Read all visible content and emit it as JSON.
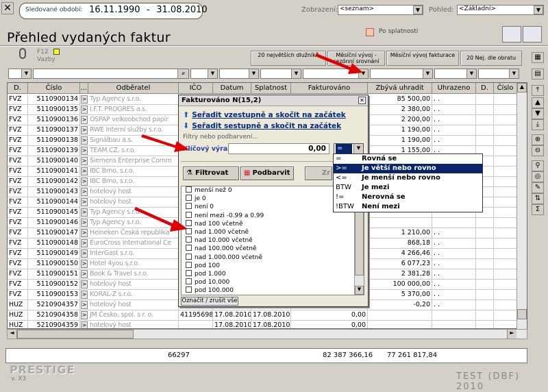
{
  "header": {
    "period_label": "Sledované období:",
    "date_from": "16.11.1990",
    "date_sep": "-",
    "date_to": "31.08.2010",
    "view_label": "Zobrazení:",
    "view_value": "<seznam>",
    "pohled_label": "Pohled:",
    "pohled_value": "<Základní>"
  },
  "title": "Přehled vydaných faktur",
  "po_splatnosti": "Po splatnosti",
  "toolbar": {
    "f12": "F12",
    "vazby": "Vazby",
    "btn1": "20 největších dlužníků",
    "btn2": "Měsíční vývoj - sezónní srovnání",
    "btn3": "Měsíční vývoj fakturace",
    "btn4": "20 Nej. dle obratu"
  },
  "columns": [
    "D.",
    "Číslo",
    "...",
    "Odběratel",
    "IČO",
    "Datum usk.",
    "Splatnost",
    "Fakturováno",
    "Zbývá uhradit",
    "Uhrazeno",
    "D.",
    "Číslo"
  ],
  "rows": [
    {
      "d": "FVZ",
      "cislo": "5110900134",
      "odb": "Typ Agency s.r.o.",
      "ico": "",
      "dusk": "",
      "spl": "",
      "fakt": "",
      "zbyva": "85 500,00",
      "uhr": ". ."
    },
    {
      "d": "FVZ",
      "cislo": "5110900135",
      "odb": "I.F.T. PROGRES a.s.",
      "ico": "",
      "dusk": "",
      "spl": "",
      "fakt": "",
      "zbyva": "2 380,00",
      "uhr": ". ."
    },
    {
      "d": "FVZ",
      "cislo": "5110900136",
      "odb": "OSPAP velkoobchod papír",
      "ico": "",
      "dusk": "",
      "spl": "",
      "fakt": "",
      "zbyva": "2 200,00",
      "uhr": ". ."
    },
    {
      "d": "FVZ",
      "cislo": "5110900137",
      "odb": "RWE Interní služby s.r.o.",
      "ico": "",
      "dusk": "",
      "spl": "",
      "fakt": "",
      "zbyva": "1 190,00",
      "uhr": ". ."
    },
    {
      "d": "FVZ",
      "cislo": "5110900138",
      "odb": "Signálbau a.s.",
      "ico": "",
      "dusk": "",
      "spl": "",
      "fakt": "",
      "zbyva": "1 190,00",
      "uhr": ". ."
    },
    {
      "d": "FVZ",
      "cislo": "5110900139",
      "odb": "TEAM.CZ, s.r.o.",
      "ico": "",
      "dusk": "",
      "spl": "",
      "fakt": "",
      "zbyva": "1 155,00",
      "uhr": ". ."
    },
    {
      "d": "FVZ",
      "cislo": "5110900140",
      "odb": "Siemens Enterprise Comm",
      "ico": "",
      "dusk": "",
      "spl": "",
      "fakt": "",
      "zbyva": "",
      "uhr": ""
    },
    {
      "d": "FVZ",
      "cislo": "5110900141",
      "odb": "IBC Brno, s.r.o.",
      "ico": "",
      "dusk": "",
      "spl": "",
      "fakt": "",
      "zbyva": "",
      "uhr": ""
    },
    {
      "d": "FVZ",
      "cislo": "5110900142",
      "odb": "IBC Brno, s.r.o.",
      "ico": "",
      "dusk": "",
      "spl": "",
      "fakt": "",
      "zbyva": "",
      "uhr": ""
    },
    {
      "d": "FVZ",
      "cislo": "5110900143",
      "odb": "hotelový host",
      "ico": "",
      "dusk": "",
      "spl": "",
      "fakt": "",
      "zbyva": "",
      "uhr": ""
    },
    {
      "d": "FVZ",
      "cislo": "5110900144",
      "odb": "hotelový host",
      "ico": "",
      "dusk": "",
      "spl": "",
      "fakt": "",
      "zbyva": "",
      "uhr": ""
    },
    {
      "d": "FVZ",
      "cislo": "5110900145",
      "odb": "Typ Agency s.r.o.",
      "ico": "",
      "dusk": "",
      "spl": "",
      "fakt": "",
      "zbyva": "",
      "uhr": ""
    },
    {
      "d": "FVZ",
      "cislo": "5110900146",
      "odb": "Typ Agency s.r.o.",
      "ico": "",
      "dusk": "",
      "spl": "",
      "fakt": "",
      "zbyva": "",
      "uhr": ""
    },
    {
      "d": "FVZ",
      "cislo": "5110900147",
      "odb": "Heineken Česká republika",
      "ico": "",
      "dusk": "",
      "spl": "",
      "fakt": "",
      "zbyva": "1 210,00",
      "uhr": ". ."
    },
    {
      "d": "FVZ",
      "cislo": "5110900148",
      "odb": "EuroCross International Ce",
      "ico": "",
      "dusk": "",
      "spl": "",
      "fakt": "",
      "zbyva": "868,18",
      "uhr": ". ."
    },
    {
      "d": "FVZ",
      "cislo": "5110900149",
      "odb": "InterGast s.r.o.",
      "ico": "",
      "dusk": "",
      "spl": "",
      "fakt": "",
      "zbyva": "4 266,46",
      "uhr": ". ."
    },
    {
      "d": "FVZ",
      "cislo": "5110900150",
      "odb": "Hotel 4you s.r.o.",
      "ico": "",
      "dusk": "",
      "spl": "",
      "fakt": "",
      "zbyva": "6 077,23",
      "uhr": ". ."
    },
    {
      "d": "FVZ",
      "cislo": "5110900151",
      "odb": "Book & Travel s.r.o.",
      "ico": "",
      "dusk": "",
      "spl": "",
      "fakt": "",
      "zbyva": "2 381,28",
      "uhr": ". ."
    },
    {
      "d": "FVZ",
      "cislo": "5110900152",
      "odb": "hotelový host",
      "ico": "",
      "dusk": "",
      "spl": "",
      "fakt": "",
      "zbyva": "100 000,00",
      "uhr": ". ."
    },
    {
      "d": "FVZ",
      "cislo": "5110900153",
      "odb": "KORAL-Z s.r.o.",
      "ico": "",
      "dusk": "",
      "spl": "",
      "fakt": "",
      "zbyva": "5 370,00",
      "uhr": ". ."
    },
    {
      "d": "HUZ",
      "cislo": "5210904357",
      "odb": "hotelový host",
      "ico": "",
      "dusk": "",
      "spl": "",
      "fakt": "",
      "zbyva": "-0,20",
      "uhr": ". ."
    },
    {
      "d": "HUZ",
      "cislo": "5210904358",
      "odb": "JM Česko, spol. s r. o.",
      "ico": "41195698",
      "dusk": "17.08.2010",
      "spl": "17.08.2010",
      "fakt": "0,00",
      "zbyva": "",
      "uhr": ""
    },
    {
      "d": "HUZ",
      "cislo": "5210904359",
      "odb": "hotelový host",
      "ico": "",
      "dusk": "17.08.2010",
      "spl": "17.08.2010",
      "fakt": "0,00",
      "zbyva": "",
      "uhr": ""
    }
  ],
  "totals": {
    "count": "66297",
    "fakturovano": "82 387 366,16",
    "zbyva": "77 261 817,84"
  },
  "popup": {
    "title": "Fakturováno N(15,2)",
    "sort_asc": "Seřadit vzestupně a skočit na začátek",
    "sort_desc": "Seřadit sestupně a skočit na začátek",
    "filters_label": "Filtry nebo podbarvení...",
    "key_label": "Klíčový výraz:",
    "key_value": "0,00",
    "operator": "=",
    "btn_filter": "Filtrovat",
    "btn_color": "Podbarvit",
    "btn_third": "Zr",
    "items": [
      "menší než 0",
      "je 0",
      "není 0",
      "není mezi -0.99 a 0.99",
      "nad 100 včetně",
      "nad 1.000 včetně",
      "nad 10.000 včetně",
      "nad 100.000 včetně",
      "nad 1.000.000 včetně",
      "pod 100",
      "pod 1.000",
      "pod 10.000",
      "pod 100.000"
    ],
    "mark_all": "Označit / zrušit vše"
  },
  "operators": [
    {
      "sym": "=",
      "label": "Rovná se"
    },
    {
      "sym": ">=",
      "label": "Je větší nebo rovno"
    },
    {
      "sym": "<=",
      "label": "Je menší nebo rovno"
    },
    {
      "sym": "BTW",
      "label": "Je mezi"
    },
    {
      "sym": "!=",
      "label": "Nerovná se"
    },
    {
      "sym": "!BTW",
      "label": "Není mezi"
    }
  ],
  "operator_selected_index": 1,
  "footer": {
    "brand": "PRESTIGE",
    "version": "v. X3",
    "test": "TEST (DBF) 2010"
  },
  "colors": {
    "selection": "#0a246a",
    "link": "#002a80",
    "annotation_arrow": "#e00000"
  }
}
